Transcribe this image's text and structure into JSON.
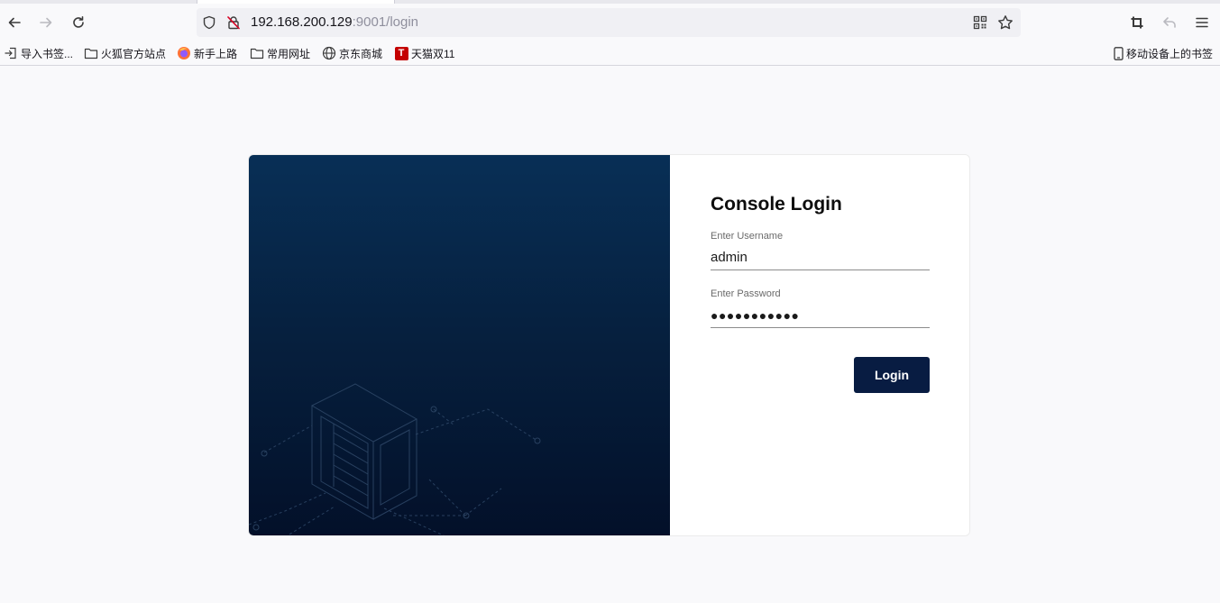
{
  "browser": {
    "url_host": "192.168.200.129",
    "url_rest": ":9001/login",
    "bookmarks": [
      {
        "label": "导入书签...",
        "icon": "import-icon"
      },
      {
        "label": "火狐官方站点",
        "icon": "folder-icon"
      },
      {
        "label": "新手上路",
        "icon": "firefox-icon"
      },
      {
        "label": "常用网址",
        "icon": "folder-icon"
      },
      {
        "label": "京东商城",
        "icon": "globe-icon"
      },
      {
        "label": "天猫双11",
        "icon": "tmall-icon"
      }
    ],
    "mobile_bookmarks": "移动设备上的书签",
    "tmall_glyph": "T"
  },
  "login": {
    "title": "Console Login",
    "username_label": "Enter Username",
    "username_value": "admin",
    "password_label": "Enter Password",
    "password_value": "●●●●●●●●●●●",
    "button_label": "Login"
  },
  "colors": {
    "panel_top": "#082f56",
    "panel_bottom": "#031029",
    "button": "#081c42"
  }
}
